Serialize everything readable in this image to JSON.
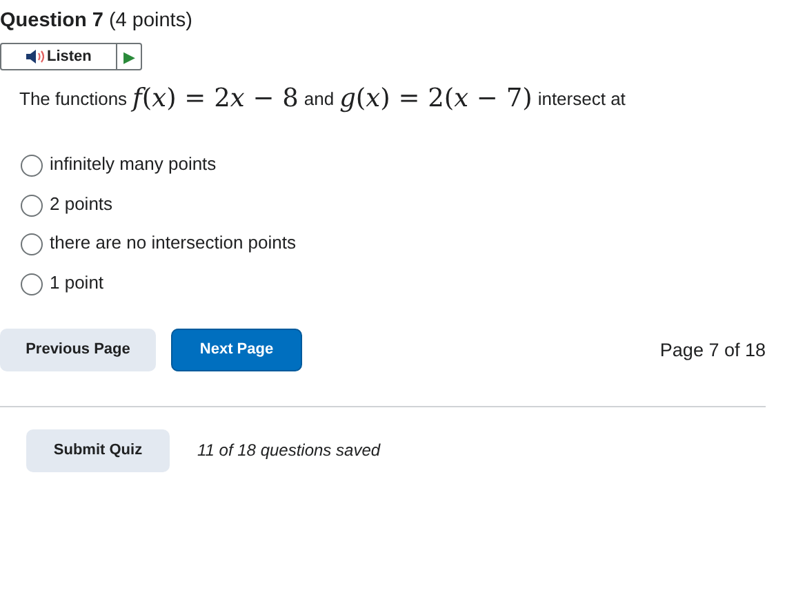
{
  "question": {
    "title": "Question 7",
    "points": "(4 points)"
  },
  "listen": {
    "label": "Listen",
    "play": "▶"
  },
  "prompt": [
    {
      "kind": "text",
      "text": "The functions"
    },
    {
      "kind": "math",
      "text": "f(x) = 2x − 8"
    },
    {
      "kind": "text",
      "text": "and"
    },
    {
      "kind": "math",
      "text": "g(x) = 2(x − 7)"
    },
    {
      "kind": "text",
      "text": "intersect at"
    }
  ],
  "options": [
    {
      "label": "infinitely many points",
      "selected": false
    },
    {
      "label": "2 points",
      "selected": false
    },
    {
      "label": "there are no intersection points",
      "selected": false
    },
    {
      "label": "1 point",
      "selected": false
    }
  ],
  "navigation": {
    "previous": "Previous Page",
    "next": "Next Page",
    "page": "Page 7 of 18"
  },
  "footer": {
    "submit": "Submit Quiz",
    "saved": "11 of 18 questions saved"
  }
}
